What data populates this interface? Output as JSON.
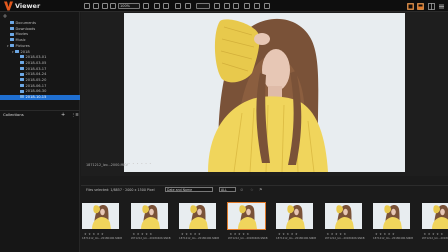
{
  "app": {
    "title": "Viewer"
  },
  "toolbar": {
    "zoom_value": "100%",
    "dropdown_value": ""
  },
  "sidebar": {
    "items": [
      {
        "label": "Documents",
        "indent": 1,
        "selected": false
      },
      {
        "label": "Downloads",
        "indent": 1,
        "selected": false
      },
      {
        "label": "Movies",
        "indent": 1,
        "selected": false
      },
      {
        "label": "Music",
        "indent": 1,
        "selected": false
      },
      {
        "label": "Pictures",
        "indent": 1,
        "selected": false
      },
      {
        "label": "2018",
        "indent": 2,
        "selected": false
      },
      {
        "label": "2018-03-01",
        "indent": 3,
        "selected": false
      },
      {
        "label": "2018-03-05",
        "indent": 3,
        "selected": false
      },
      {
        "label": "2018-03-17",
        "indent": 3,
        "selected": false
      },
      {
        "label": "2018-04-24",
        "indent": 3,
        "selected": false
      },
      {
        "label": "2018-05-20",
        "indent": 3,
        "selected": false
      },
      {
        "label": "2018-06-17",
        "indent": 3,
        "selected": false
      },
      {
        "label": "2018-06-30",
        "indent": 3,
        "selected": false
      },
      {
        "label": "2018-10-15",
        "indent": 3,
        "selected": true
      }
    ],
    "collections_label": "Collections"
  },
  "viewer": {
    "status": "1871212_lzo...2000.MKV",
    "rating_dots": "• • • • • •"
  },
  "filmstrip": {
    "files_selected": "Files selected: 1/8857 · 2000 x 1500 Pixel",
    "sort_value": "Date and Name",
    "filter_value": "ALL",
    "thumbs": [
      {
        "caption": "1871212_lzo...20180406.SNKB",
        "stars": "★ ★ ★ ★ ★",
        "selected": false
      },
      {
        "caption": "1871212_lzo...20180406.SNKB",
        "stars": "★ ★ ★ ★ ★",
        "selected": false
      },
      {
        "caption": "1871212_lzo...20180406.SNKB",
        "stars": "★ ★ ★ ★ ★",
        "selected": false
      },
      {
        "caption": "1871212_lzo...20180406.SNKB",
        "stars": "★ ★ ★ ★ ★",
        "selected": true
      },
      {
        "caption": "1871212_lzo...20180406.SNKB",
        "stars": "★ ★ ★ ★ ★",
        "selected": false
      },
      {
        "caption": "1871212_lzo...20180406.SNKB",
        "stars": "★ ★ ★ ★ ★",
        "selected": false
      },
      {
        "caption": "1871212_lzo...20180406.SNKB",
        "stars": "★ ★ ★ ★ ★",
        "selected": false
      },
      {
        "caption": "1871212_lzo...20180406.SNKB",
        "stars": "★ ★ ★ ★ ★",
        "selected": false
      }
    ]
  },
  "colors": {
    "accent": "#e07a2a",
    "selection": "#1f6fd1",
    "logo": "#e2581d"
  }
}
